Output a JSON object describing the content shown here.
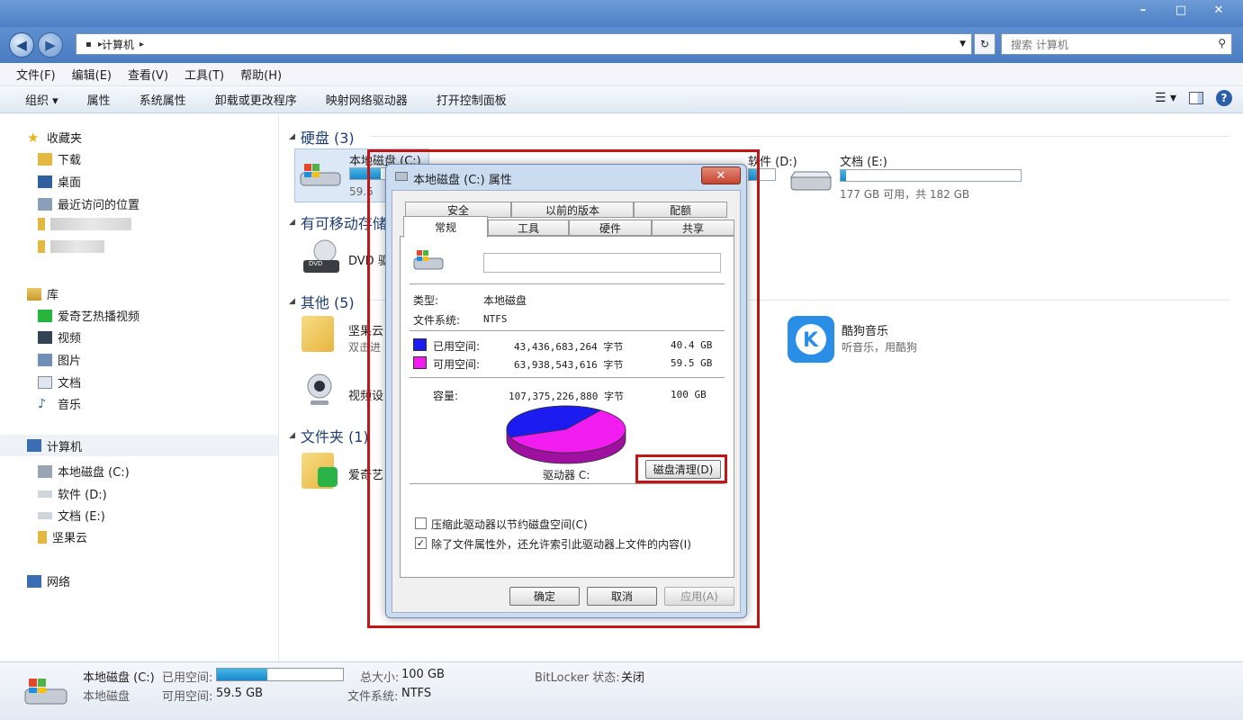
{
  "window": {
    "controls": {
      "minimize": "–",
      "maximize": "□",
      "close": "✕"
    }
  },
  "address": {
    "back": "◀",
    "forward": "▶",
    "crumb": "计算机",
    "search_placeholder": "搜索 计算机"
  },
  "menu": [
    "文件(F)",
    "编辑(E)",
    "查看(V)",
    "工具(T)",
    "帮助(H)"
  ],
  "toolbar": {
    "organize": "组织 ▾",
    "items": [
      "属性",
      "系统属性",
      "卸载或更改程序",
      "映射网络驱动器",
      "打开控制面板"
    ]
  },
  "sidebar": {
    "favorites": {
      "label": "收藏夹",
      "items": [
        "下载",
        "桌面",
        "最近访问的位置"
      ]
    },
    "libraries": {
      "label": "库",
      "items": [
        "爱奇艺热播视频",
        "视频",
        "图片",
        "文档",
        "音乐"
      ]
    },
    "computer": {
      "label": "计算机",
      "items": [
        "本地磁盘 (C:)",
        "软件 (D:)",
        "文档 (E:)",
        "坚果云"
      ]
    },
    "network": {
      "label": "网络"
    }
  },
  "main": {
    "groups": {
      "hdd": "硬盘 (3)",
      "removable": "有可移动存储",
      "other": "其他 (5)",
      "folder": "文件夹 (1)"
    },
    "drives": {
      "c": {
        "name": "本地磁盘 (C:)",
        "free_text": "59.5",
        "used_fraction": 0.4
      },
      "d": {
        "name": "软件 (D:)",
        "used_fraction": 0.3
      },
      "e": {
        "name": "文档 (E:)",
        "free_text": "177 GB 可用，共 182 GB",
        "used_fraction": 0.03
      }
    },
    "dvd": "DVD 驱",
    "other_items": {
      "jianguoyun": "坚果云",
      "jianguoyun_sub": "双击进",
      "camera": "视频设",
      "kugou": "酷狗音乐",
      "kugou_sub": "听音乐，用酷狗"
    },
    "folder_item": "爱奇艺"
  },
  "dialog": {
    "title": "本地磁盘 (C:) 属性",
    "close": "✕",
    "tabs_top": [
      "安全",
      "以前的版本",
      "配额"
    ],
    "tabs_bottom": [
      "常规",
      "工具",
      "硬件",
      "共享"
    ],
    "active_tab": "常规",
    "type_label": "类型:",
    "type_value": "本地磁盘",
    "fs_label": "文件系统:",
    "fs_value": "NTFS",
    "used_label": "已用空间:",
    "used_bytes": "43,436,683,264 字节",
    "used_gb": "40.4 GB",
    "free_label": "可用空间:",
    "free_bytes": "63,938,543,616 字节",
    "free_gb": "59.5 GB",
    "cap_label": "容量:",
    "cap_bytes": "107,375,226,880 字节",
    "cap_gb": "100 GB",
    "drive_label": "驱动器 C:",
    "cleanup_button": "磁盘清理(D)",
    "compress_label": "压缩此驱动器以节约磁盘空间(C)",
    "compress_checked": false,
    "index_label": "除了文件属性外，还允许索引此驱动器上文件的内容(I)",
    "index_checked": true,
    "ok": "确定",
    "cancel": "取消",
    "apply": "应用(A)",
    "check_mark": "✓",
    "used_color": "#1c1cf0",
    "free_color": "#f01cf0"
  },
  "statusbar": {
    "name": "本地磁盘 (C:)",
    "type": "本地磁盘",
    "used_label": "已用空间:",
    "free_label": "可用空间:",
    "free_value": "59.5 GB",
    "total_label": "总大小:",
    "total_value": "100 GB",
    "fs_label": "文件系统:",
    "fs_value": "NTFS",
    "bitlocker_label": "BitLocker 状态:",
    "bitlocker_value": "关闭"
  }
}
